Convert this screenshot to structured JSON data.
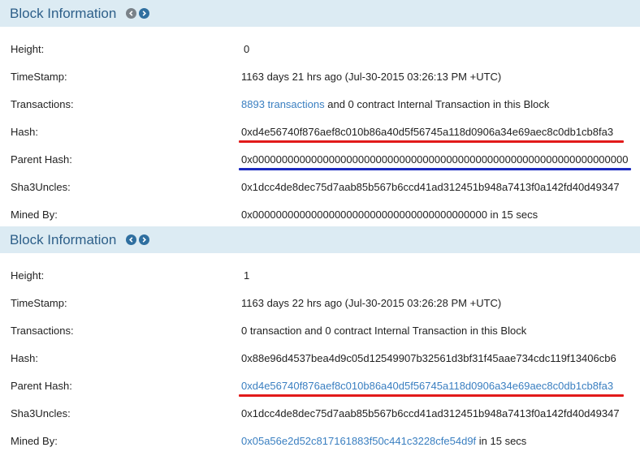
{
  "colors": {
    "header_bg": "#dcebf3",
    "title": "#2d5f89",
    "link": "#3a7fc1",
    "underline_red": "#e21a1a",
    "underline_blue": "#1c2ac0"
  },
  "blocks": [
    {
      "title": "Block Information",
      "height": {
        "label": "Height:",
        "value": "0"
      },
      "timestamp": {
        "label": "TimeStamp:",
        "value": "1163 days 21 hrs ago (Jul-30-2015 03:26:13 PM +UTC)"
      },
      "transactions": {
        "label": "Transactions:",
        "link": "8893 transactions",
        "rest": " and 0 contract Internal Transaction in this Block"
      },
      "hash": {
        "label": "Hash:",
        "value": "0xd4e56740f876aef8c010b86a40d5f56745a118d0906a34e69aec8c0db1cb8fa3"
      },
      "parent_hash": {
        "label": "Parent Hash:",
        "value": "0x0000000000000000000000000000000000000000000000000000000000000000"
      },
      "sha3uncles": {
        "label": "Sha3Uncles:",
        "value": "0x1dcc4de8dec75d7aab85b567b6ccd41ad312451b948a7413f0a142fd40d49347"
      },
      "mined_by": {
        "label": "Mined By:",
        "address": "0x0000000000000000000000000000000000000000",
        "rest": " in 15 secs"
      }
    },
    {
      "title": "Block Information",
      "height": {
        "label": "Height:",
        "value": "1"
      },
      "timestamp": {
        "label": "TimeStamp:",
        "value": "1163 days 22 hrs ago (Jul-30-2015 03:26:28 PM +UTC)"
      },
      "transactions": {
        "label": "Transactions:",
        "value": "0 transaction and 0 contract Internal Transaction in this Block"
      },
      "hash": {
        "label": "Hash:",
        "value": "0x88e96d4537bea4d9c05d12549907b32561d3bf31f45aae734cdc119f13406cb6"
      },
      "parent_hash": {
        "label": "Parent Hash:",
        "value": "0xd4e56740f876aef8c010b86a40d5f56745a118d0906a34e69aec8c0db1cb8fa3"
      },
      "sha3uncles": {
        "label": "Sha3Uncles:",
        "value": "0x1dcc4de8dec75d7aab85b567b6ccd41ad312451b948a7413f0a142fd40d49347"
      },
      "mined_by": {
        "label": "Mined By:",
        "address": "0x05a56e2d52c817161883f50c441c3228cfe54d9f",
        "rest": " in 15 secs"
      }
    }
  ]
}
